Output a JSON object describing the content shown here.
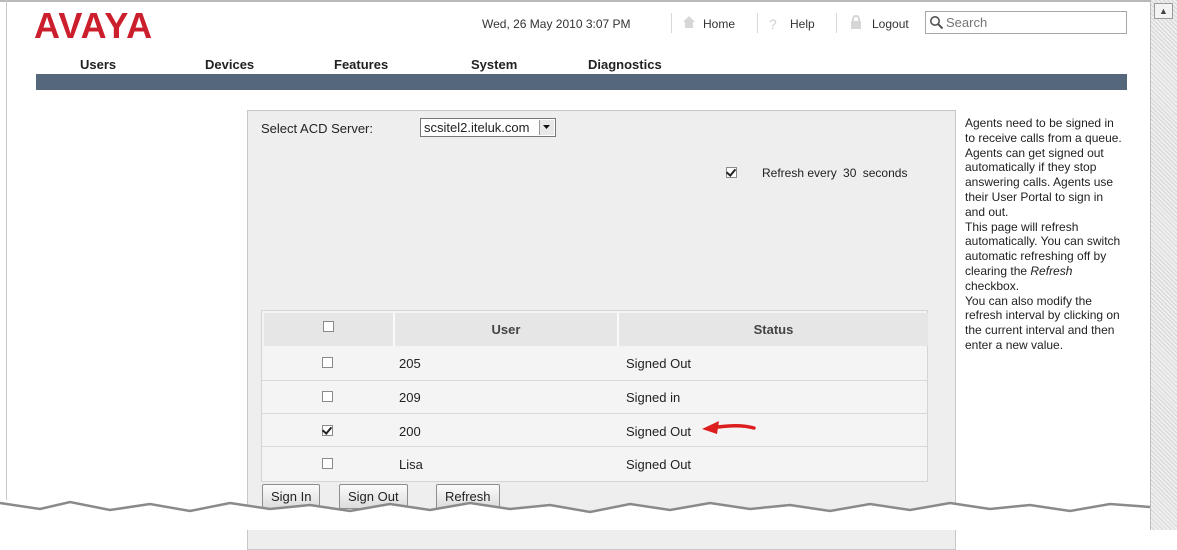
{
  "header": {
    "logo_text": "AVAYA",
    "datetime": "Wed, 26 May 2010 3:07 PM",
    "home_label": "Home",
    "help_label": "Help",
    "logout_label": "Logout",
    "search_placeholder": "Search",
    "brand_color": "#cc1f2d",
    "bar_color": "#55687b"
  },
  "nav": {
    "items": [
      {
        "label": "Users"
      },
      {
        "label": "Devices"
      },
      {
        "label": "Features"
      },
      {
        "label": "System"
      },
      {
        "label": "Diagnostics"
      }
    ]
  },
  "main": {
    "server_label": "Select ACD Server:",
    "server_value": "scsitel2.iteluk.com",
    "refresh_checked": true,
    "refresh_prefix": "Refresh every",
    "refresh_interval": "30",
    "refresh_suffix": "seconds",
    "table": {
      "columns": [
        "User",
        "Status"
      ],
      "rows": [
        {
          "checked": false,
          "user": "205",
          "status": "Signed Out"
        },
        {
          "checked": false,
          "user": "209",
          "status": "Signed in"
        },
        {
          "checked": true,
          "user": "200",
          "status": "Signed Out"
        },
        {
          "checked": false,
          "user": "Lisa",
          "status": "Signed Out"
        }
      ]
    },
    "buttons": {
      "sign_in": "Sign In",
      "sign_out": "Sign Out",
      "refresh": "Refresh"
    }
  },
  "help_text": {
    "p1": "Agents need to be signed in to receive calls from a queue. Agents can get signed out automatically if they stop answering calls. Agents use their User Portal to sign in and out.",
    "p2_pre": "This page will refresh automatically. You can switch automatic refreshing off by clearing the",
    "p2_em": "Refresh",
    "p2_post": "checkbox.",
    "p3": "You can also modify the refresh interval by clicking on the current interval and then enter a new value."
  }
}
